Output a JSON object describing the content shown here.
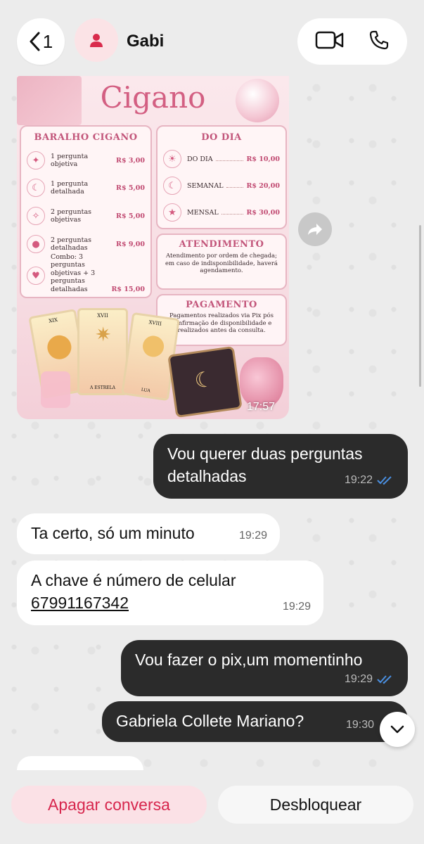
{
  "header": {
    "back_count": "1",
    "contact_name": "Gabi"
  },
  "poster": {
    "title": "Cigano",
    "baralho": {
      "title": "BARALHO CIGANO",
      "items": [
        {
          "label": "1 pergunta objetiva",
          "price": "R$ 3,00",
          "icon": "star-icon"
        },
        {
          "label": "1 pergunta detalhada",
          "price": "R$ 5,00",
          "icon": "moon-icon"
        },
        {
          "label": "2 perguntas objetivas",
          "price": "R$ 5,00",
          "icon": "sparkle-icon"
        },
        {
          "label": "2 perguntas detalhadas",
          "price": "R$ 9,00",
          "icon": "crystal-ball-icon"
        },
        {
          "label": "Combo: 3 perguntas objetivas + 3 perguntas detalhadas",
          "price": "R$ 15,00",
          "icon": "heart-icon"
        }
      ]
    },
    "do_dia": {
      "title": "DO DIA",
      "items": [
        {
          "label": "DO DIA",
          "price": "R$ 10,00",
          "icon": "sun-icon"
        },
        {
          "label": "SEMANAL",
          "price": "R$ 20,00",
          "icon": "moon-icon"
        },
        {
          "label": "MENSAL",
          "price": "R$ 30,00",
          "icon": "star-icon"
        }
      ]
    },
    "atendimento": {
      "title": "ATENDIMENTO",
      "text": "Atendimento por ordem de chegada; em caso de indisponibilidade, haverá agendamento."
    },
    "pagamento": {
      "title": "PAGAMENTO",
      "text": "Pagamentos realizados via Pix pós confirmação de disponibilidade e realizados antes da consulta."
    },
    "cards": [
      "XIX",
      "XVII",
      "XVIII",
      "A ESTRELA",
      "LUA"
    ],
    "time": "17:57"
  },
  "messages": [
    {
      "direction": "out",
      "text_line1": "Vou querer duas perguntas",
      "text_line2": "detalhadas",
      "time": "19:22"
    },
    {
      "direction": "in",
      "text": "Ta certo, só um minuto",
      "time": "19:29"
    },
    {
      "direction": "in",
      "text_line1": "A chave é número de celular",
      "link": "67991167342",
      "time": "19:29"
    },
    {
      "direction": "out",
      "text": "Vou fazer o pix,um momentinho",
      "time": "19:29"
    },
    {
      "direction": "out",
      "text": "Gabriela Collete Mariano?",
      "time": "19:30"
    }
  ],
  "bottom": {
    "delete_label": "Apagar conversa",
    "unblock_label": "Desbloquear"
  },
  "colors": {
    "outgoing_bubble": "#2b2b2b",
    "incoming_bubble": "#ffffff",
    "delete_text": "#d7264d",
    "read_tick": "#4a8fe0"
  }
}
